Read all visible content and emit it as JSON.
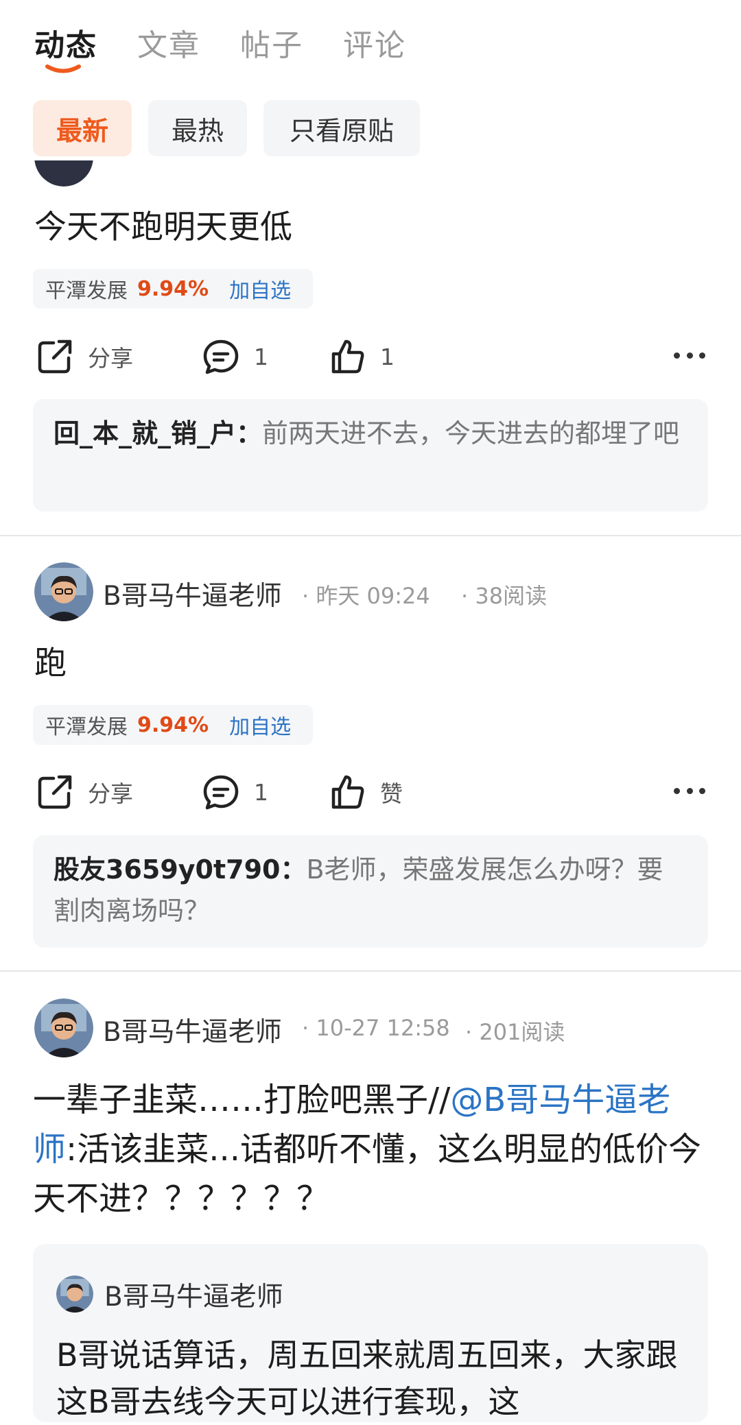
{
  "tabs": [
    {
      "label": "动态",
      "active": true
    },
    {
      "label": "文章",
      "active": false
    },
    {
      "label": "帖子",
      "active": false
    },
    {
      "label": "评论",
      "active": false
    }
  ],
  "filters": [
    {
      "label": "最新",
      "active": true
    },
    {
      "label": "最热",
      "active": false
    },
    {
      "label": "只看原贴",
      "active": false
    }
  ],
  "posts": [
    {
      "text": "今天不跑明天更低",
      "stock": {
        "name": "平潭发展",
        "change": "9.94%",
        "add_label": "加自选"
      },
      "actions": {
        "share": "分享",
        "comments": "1",
        "likes": "1"
      },
      "comment": {
        "user": "回_本_就_销_户：",
        "text": "前两天进不去，今天进去的都埋了吧"
      }
    },
    {
      "author": "B哥马牛逼老师",
      "time": "· 昨天 09:24",
      "reads": "· 38阅读",
      "text": "跑",
      "stock": {
        "name": "平潭发展",
        "change": "9.94%",
        "add_label": "加自选"
      },
      "actions": {
        "share": "分享",
        "comments": "1",
        "likes": "赞"
      },
      "comment": {
        "user": "股友3659y0t790：",
        "text": "B老师，荣盛发展怎么办呀？要割肉离场吗？"
      }
    },
    {
      "author": "B哥马牛逼老师",
      "time": "· 10-27 12:58",
      "reads": "· 201阅读",
      "text_before": "一辈子韭菜……打脸吧黑子//",
      "mention": "@B哥马牛逼老师",
      "text_after": ":活该韭菜...话都听不懂，这么明显的低价今天不进？？？？？？",
      "quote": {
        "author": "B哥马牛逼老师",
        "text": "B哥说话算话，周五回来就周五回来，大家跟这B哥去线今天可以进行套现，这"
      }
    }
  ],
  "colors": {
    "accent": "#ee5a1d",
    "link": "#2b74c5",
    "price_up": "#e04a16"
  },
  "icons": [
    "share-icon",
    "comment-icon",
    "like-icon",
    "more-icon",
    "avatar"
  ]
}
